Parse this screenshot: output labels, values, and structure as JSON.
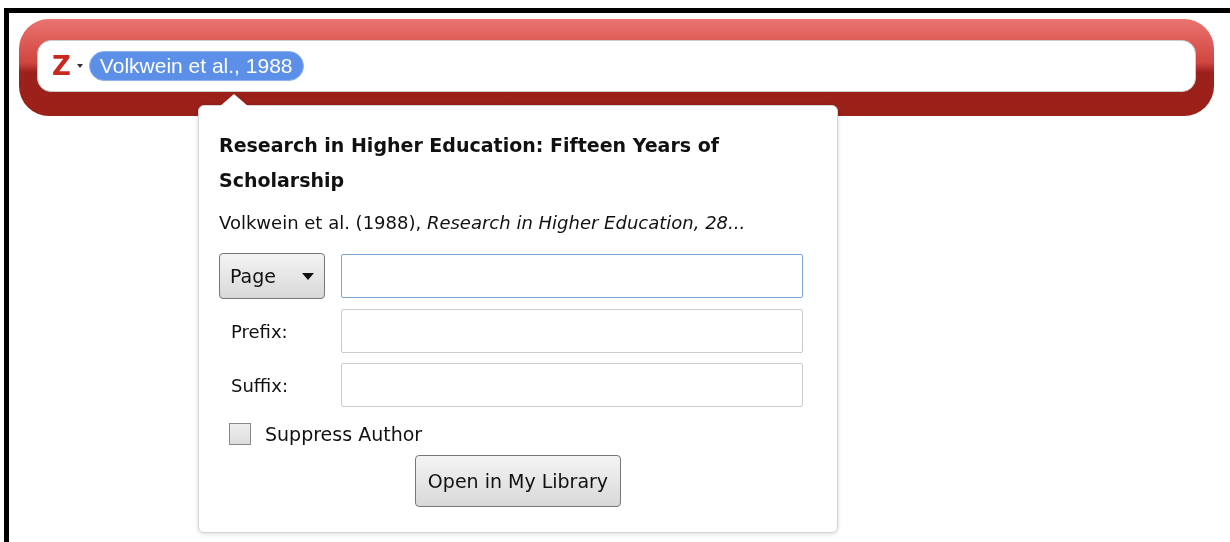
{
  "toolbar": {
    "logo": "Z",
    "citation_bubble": {
      "label": "Volkwein et al., 1988",
      "selected": true
    }
  },
  "popup": {
    "title": "Research in Higher Education: Fifteen Years of Scholarship",
    "citation": "Volkwein et al. (1988), *Research in Higher Education, 28...*",
    "locator": {
      "label": "Page",
      "focused": true
    },
    "fields": [
      {
        "label": "Prefix:"
      },
      {
        "label": "Suffix:"
      }
    ],
    "suppress_author": {
      "label": "Suppress Author",
      "checked": false
    },
    "button": "Open in My Library"
  }
}
